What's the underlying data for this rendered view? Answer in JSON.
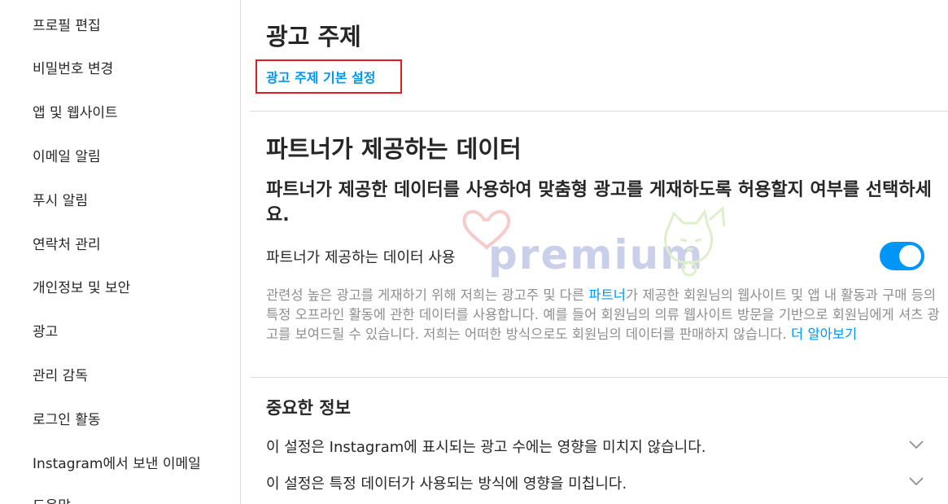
{
  "sidebar": {
    "items": [
      {
        "label": "프로필 편집"
      },
      {
        "label": "비밀번호 변경"
      },
      {
        "label": "앱 및 웹사이트"
      },
      {
        "label": "이메일 알림"
      },
      {
        "label": "푸시 알림"
      },
      {
        "label": "연락처 관리"
      },
      {
        "label": "개인정보 및 보안"
      },
      {
        "label": "광고"
      },
      {
        "label": "관리 감독"
      },
      {
        "label": "로그인 활동"
      },
      {
        "label": "Instagram에서 보낸 이메일"
      },
      {
        "label": "도움말"
      }
    ]
  },
  "main": {
    "title": "광고 주제",
    "preferences_link": "광고 주제 기본 설정",
    "partner_section": {
      "title": "파트너가 제공하는 데이터",
      "question": "파트너가 제공한 데이터를 사용하여 맞춤형 광고를 게재하도록 허용할지 여부를 선택하세요.",
      "toggle_label": "파트너가 제공하는 데이터 사용",
      "toggle_on": true,
      "description_part1": "관련성 높은 광고를 게재하기 위해 저희는 광고주 및 다른 ",
      "description_link1": "파트너",
      "description_part2": "가 제공한 회원님의 웹사이트 및 앱 내 활동과 구매 등의 특정 오프라인 활동에 관한 데이터를 사용합니다. 예를 들어 회원님의 의류 웹사이트 방문을 기반으로 회원님에게 셔츠 광고를 보여드릴 수 있습니다. 저희는 어떠한 방식으로도 회원님의 데이터를 판매하지 않습니다. ",
      "description_link2": "더 알아보기"
    },
    "important_info": {
      "title": "중요한 정보",
      "rows": [
        {
          "text": "이 설정은 Instagram에 표시되는 광고 수에는 영향을 미치지 않습니다."
        },
        {
          "text": "이 설정은 특정 데이터가 사용되는 방식에 영향을 미칩니다."
        }
      ]
    }
  },
  "watermark": {
    "text": "premium"
  },
  "colors": {
    "accent": "#0095f6",
    "highlight_box": "#e01e1e",
    "divider": "#dbdbdb",
    "muted_text": "#8e8e8e"
  }
}
